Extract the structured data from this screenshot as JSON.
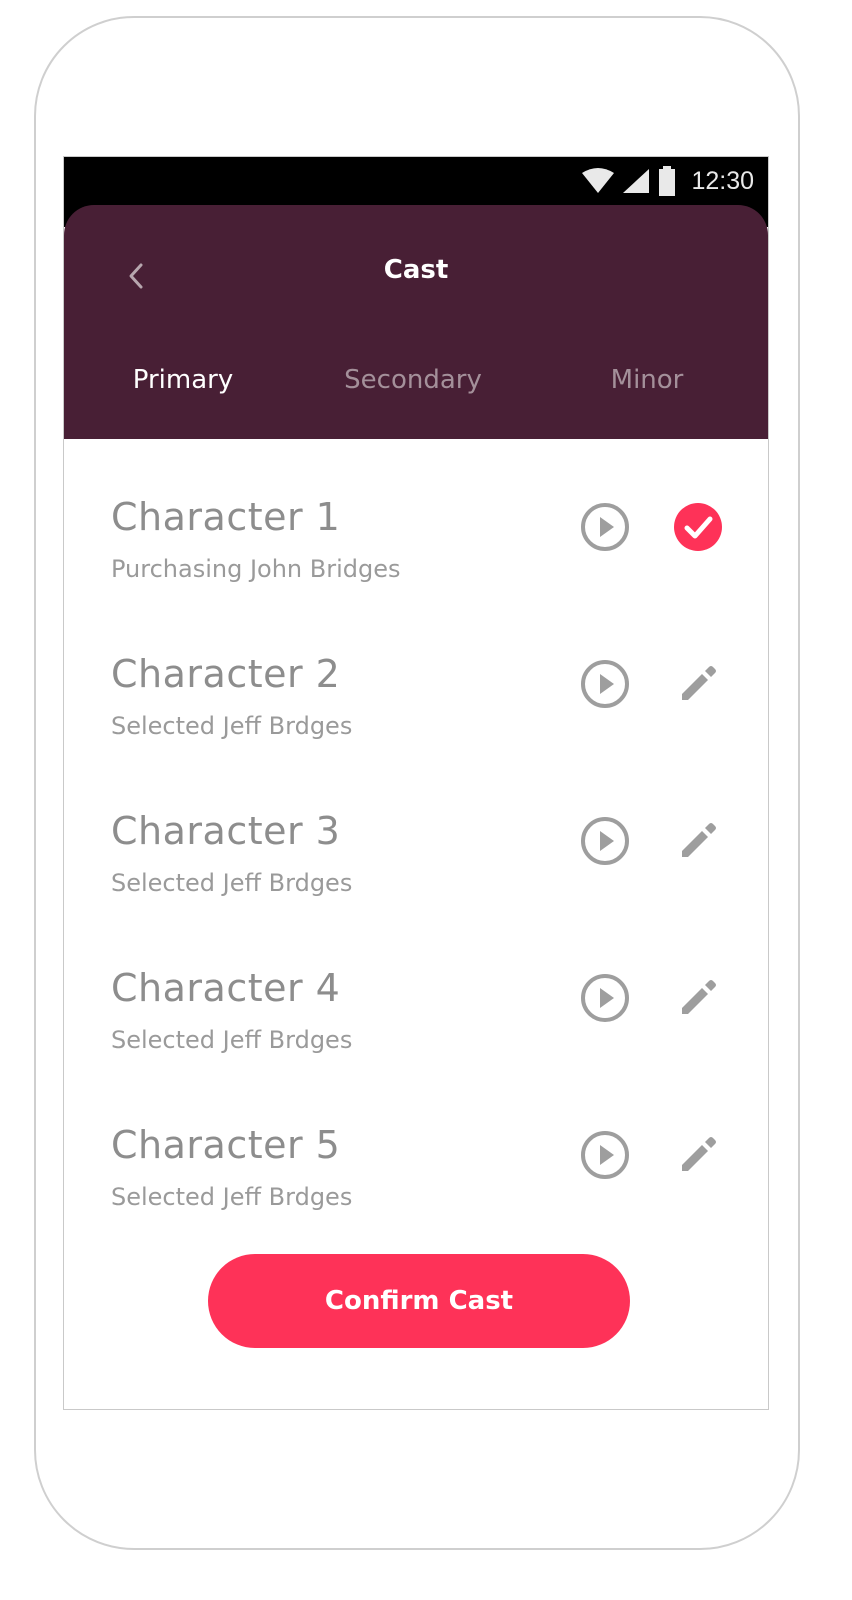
{
  "status_bar": {
    "time": "12:30"
  },
  "header": {
    "title": "Cast",
    "tabs": [
      {
        "label": "Primary",
        "active": true
      },
      {
        "label": "Secondary",
        "active": false
      },
      {
        "label": "Minor",
        "active": false
      }
    ]
  },
  "characters": [
    {
      "name": "Character 1",
      "status": "Purchasing John Bridges",
      "action_icon": "check-circle-icon"
    },
    {
      "name": "Character 2",
      "status": "Selected Jeff Brdges",
      "action_icon": "pencil-icon"
    },
    {
      "name": "Character 3",
      "status": "Selected Jeff Brdges",
      "action_icon": "pencil-icon"
    },
    {
      "name": "Character 4",
      "status": "Selected Jeff Brdges",
      "action_icon": "pencil-icon"
    },
    {
      "name": "Character 5",
      "status": "Selected Jeff Brdges",
      "action_icon": "pencil-icon"
    }
  ],
  "confirm_label": "Confirm Cast",
  "colors": {
    "header_bg": "#481f35",
    "accent": "#fe3258",
    "text_muted": "#8d8d8d",
    "tab_inactive": "#a4909a"
  }
}
